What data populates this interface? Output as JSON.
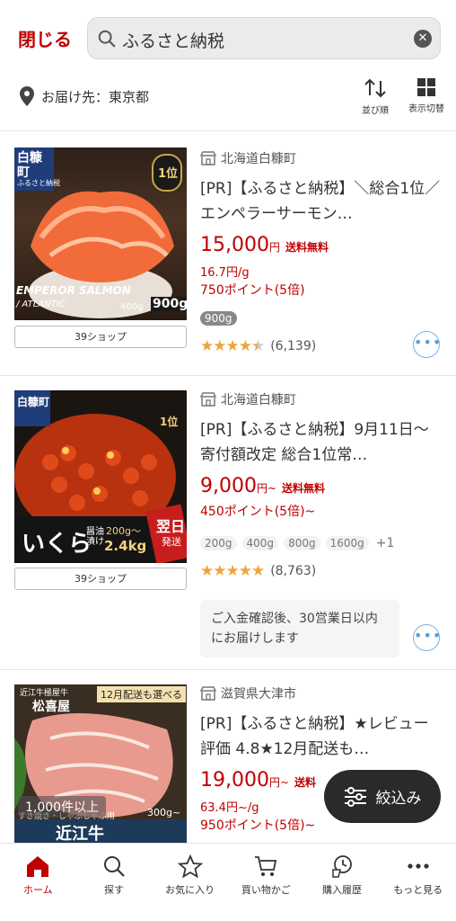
{
  "header": {
    "close_label": "閉じる",
    "search_value": "ふるさと納税",
    "clear_icon": "close-icon"
  },
  "delivery": {
    "label": "お届け先：東京都"
  },
  "toolbar": {
    "sort_label": "並び順",
    "view_label": "表示切替"
  },
  "products": [
    {
      "shop_label": "39ショップ",
      "municipality": "北海道白糠町",
      "title": "[PR]【ふるさと納税】＼総合1位／エンペラーサーモン…",
      "price": "15,000",
      "yen": "円",
      "shipping": "送料無料",
      "per_unit": "16.7円/g",
      "points": "750ポイント(5倍)",
      "variations": [
        "900g"
      ],
      "rating": 4.5,
      "stars": "★★★★★",
      "review_count": "(6,139)",
      "image_text": {
        "brand": "白糠町",
        "sub": "ふるさと納税",
        "rank": "1位",
        "name": "EMPEROR SALMON",
        "name2": "/ ATLANTIC",
        "weight": "400g",
        "weight2": "900g"
      },
      "colors": {
        "top": "#3a2a1e",
        "fish": "#f07a4a"
      }
    },
    {
      "shop_label": "39ショップ",
      "municipality": "北海道白糠町",
      "title": "[PR]【ふるさと納税】9月11日〜寄付額改定 総合1位常…",
      "price": "9,000",
      "yen": "円~",
      "shipping": "送料無料",
      "points": "450ポイント(5倍)~",
      "variations": [
        "200g",
        "400g",
        "800g",
        "1600g"
      ],
      "more_variations": "+1",
      "rating": 5.0,
      "stars": "★★★★★",
      "review_count": "(8,763)",
      "note": "ご入金確認後、30営業日以内にお届けします",
      "image_text": {
        "brand": "白糠町",
        "title": "いくら",
        "sub": "醤油漬け",
        "weight": "200g〜",
        "weight2": "2.4kg",
        "badge": "翌日",
        "badge2": "発送",
        "rank": "1位"
      }
    },
    {
      "municipality": "滋賀県大津市",
      "title": "[PR]【ふるさと納税】★レビュー評価 4.8★12月配送も…",
      "price": "19,000",
      "yen": "円~",
      "shipping": "送料",
      "per_unit": "63.4円~/g",
      "points": "950ポイント(5倍)~",
      "image_text": {
        "brand": "松喜屋",
        "top": "近江牛極屋牛",
        "ribbon": "12月配送も選べる",
        "count": "1,000件以上",
        "sub": "すき焼き・しゃぶしゃぶ用",
        "weight": "300g~",
        "name": "近江牛"
      }
    }
  ],
  "filter_button": {
    "label": "絞込み"
  },
  "bottom_nav": [
    {
      "label": "ホーム",
      "icon": "home-icon",
      "active": true
    },
    {
      "label": "探す",
      "icon": "search-icon"
    },
    {
      "label": "お気に入り",
      "icon": "star-icon"
    },
    {
      "label": "買い物かご",
      "icon": "cart-icon"
    },
    {
      "label": "購入履歴",
      "icon": "history-icon"
    },
    {
      "label": "もっと見る",
      "icon": "more-icon"
    }
  ],
  "accent_color": "#bf0000"
}
